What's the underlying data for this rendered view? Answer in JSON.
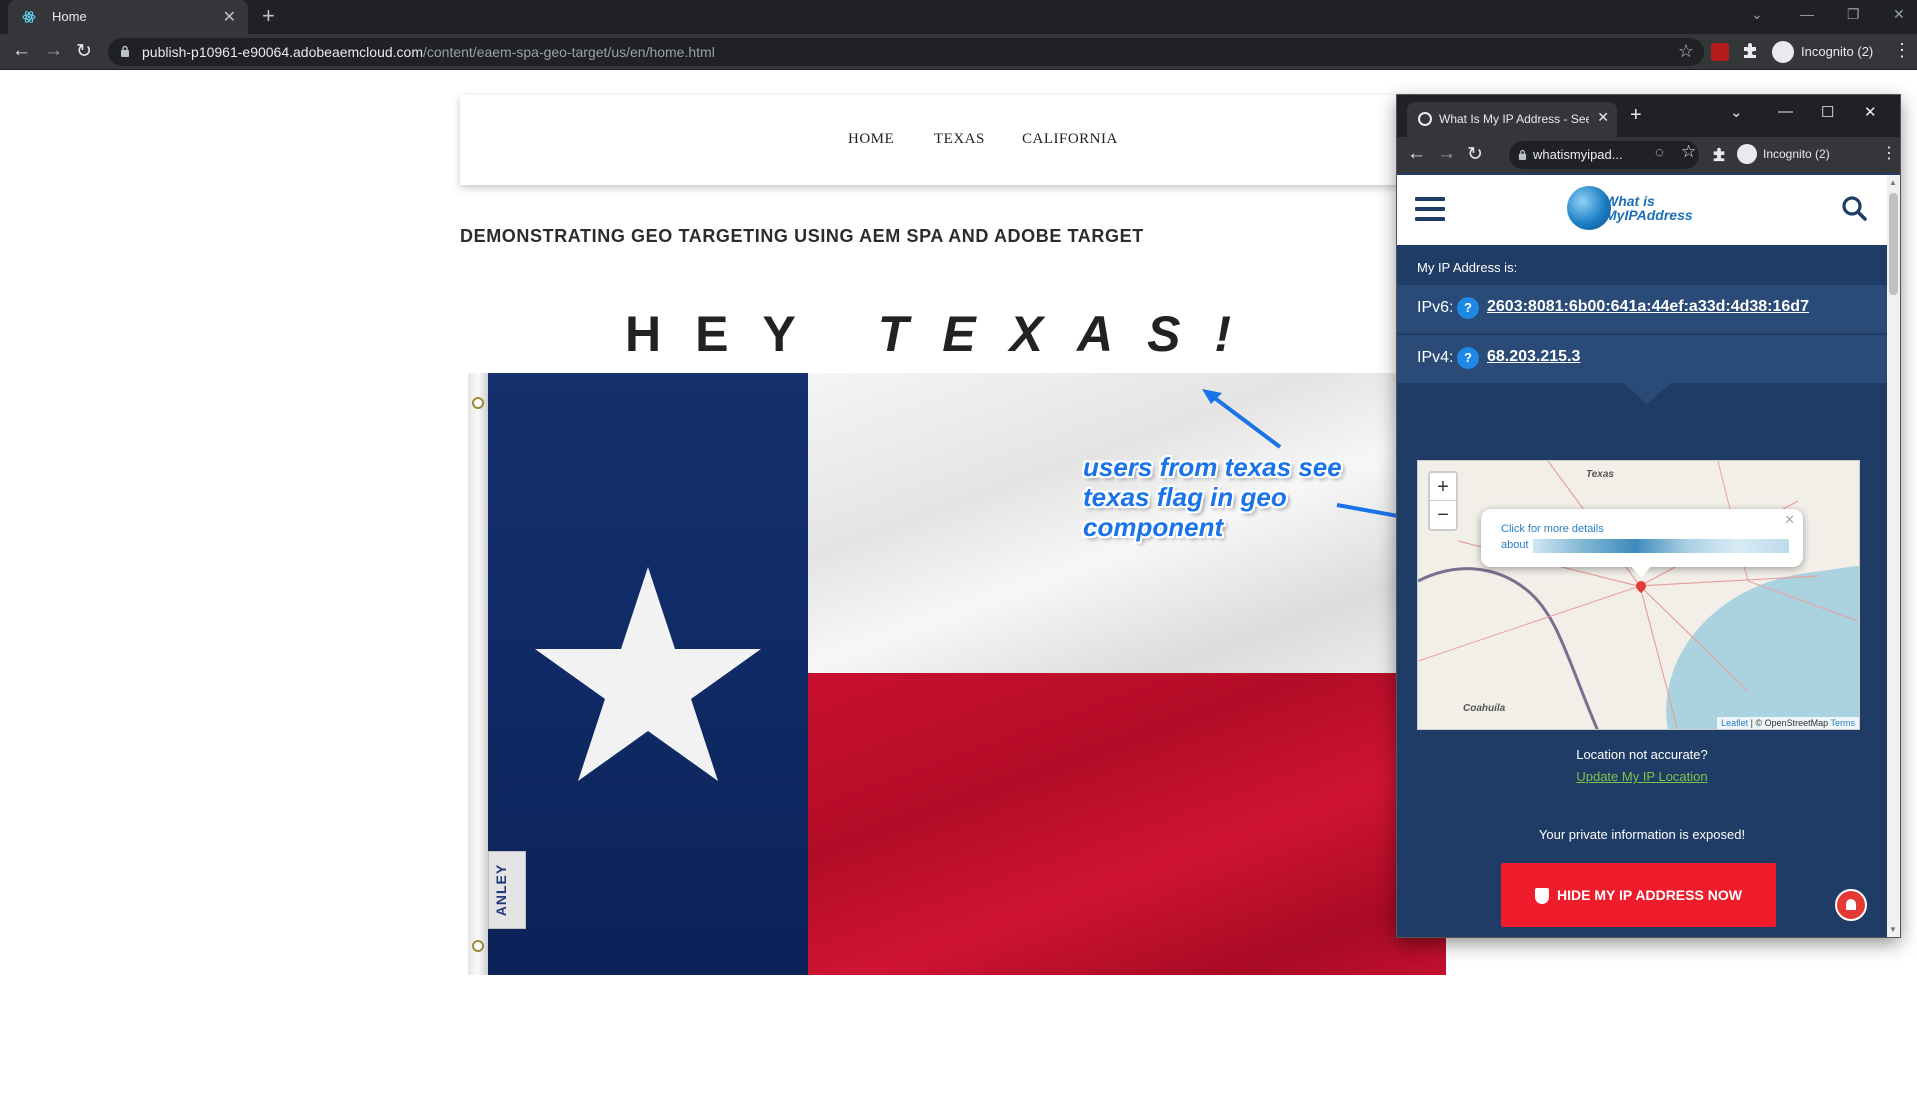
{
  "browser": {
    "tab_title": "Home",
    "url_host": "publish-p10961-e90064.adobeaemcloud.com",
    "url_path": "/content/eaem-spa-geo-target/us/en/home.html",
    "profile_label": "Incognito (2)"
  },
  "site": {
    "nav": [
      "HOME",
      "TEXAS",
      "CALIFORNIA"
    ],
    "headline": "DEMONSTRATING GEO TARGETING USING AEM SPA AND ADOBE TARGET",
    "greeting_prefix": "HEY",
    "greeting_state": "TEXAS!",
    "flag_tag": "ANLEY"
  },
  "annotation": {
    "text": "users from texas see texas flag in geo component"
  },
  "popup_window": {
    "tab_title": "What Is My IP Address - See Your",
    "url": "whatismyipad...",
    "profile_label": "Incognito (2)",
    "logo_line1": "What is",
    "logo_line2": "MyIPAddress",
    "my_ip_label": "My IP Address is:",
    "ipv6_label": "IPv6:",
    "ipv6_value": "2603:8081:6b00:641a:44ef:a33d:4d38:16d7",
    "ipv4_label": "IPv4:",
    "ipv4_value": "68.203.215.3",
    "map": {
      "label_texas": "Texas",
      "label_coahuila": "Coahuila",
      "popup_line1": "Click for more details",
      "popup_line2": "about",
      "attribution_leaflet": "Leaflet",
      "attribution_osm": "| © OpenStreetMap",
      "attribution_terms": "Terms"
    },
    "location_question": "Location not accurate?",
    "update_link": "Update My IP Location",
    "exposed_text": "Your private information is exposed!",
    "hide_button": "HIDE MY IP ADDRESS NOW"
  }
}
